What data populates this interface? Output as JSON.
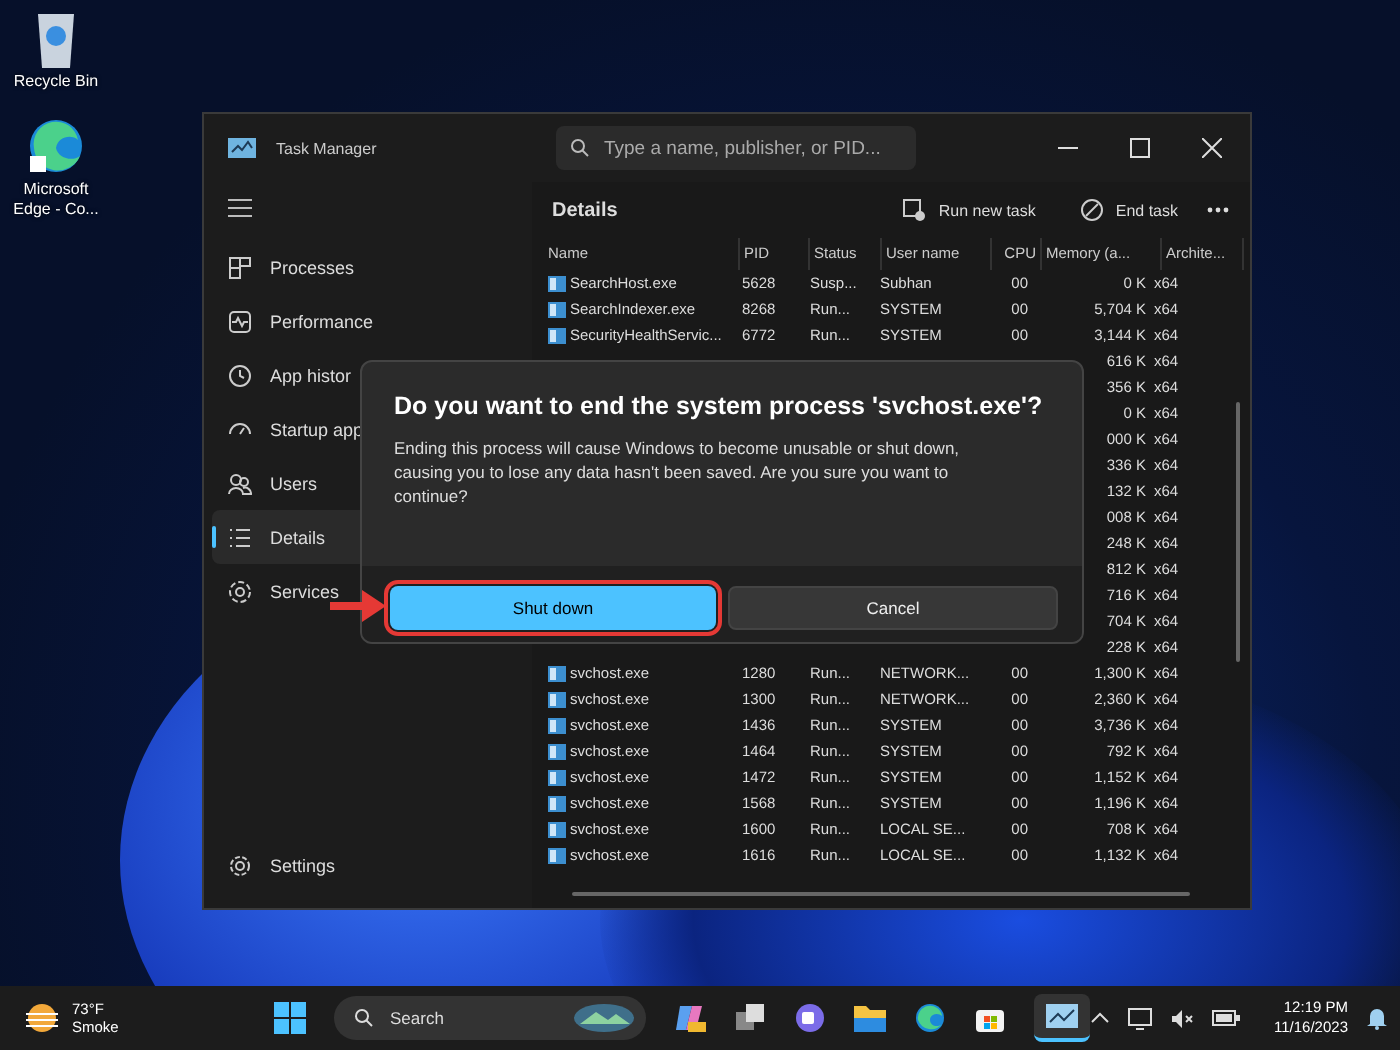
{
  "desktop_icons": [
    {
      "label": "Recycle Bin",
      "kind": "bin"
    },
    {
      "label": "Microsoft Edge - Co...",
      "kind": "edge"
    }
  ],
  "window": {
    "title": "Task Manager",
    "search": {
      "placeholder": "Type a name, publisher, or PID..."
    },
    "nav": [
      {
        "label": "Processes",
        "kind": "processes",
        "selected": false
      },
      {
        "label": "Performance",
        "kind": "performance",
        "selected": false
      },
      {
        "label": "App histor",
        "kind": "history",
        "selected": false
      },
      {
        "label": "Startup app",
        "kind": "startup",
        "selected": false
      },
      {
        "label": "Users",
        "kind": "users",
        "selected": false
      },
      {
        "label": "Details",
        "kind": "details",
        "selected": true
      },
      {
        "label": "Services",
        "kind": "services",
        "selected": false
      }
    ],
    "settings": "Settings",
    "page_title": "Details",
    "toolbar": [
      {
        "label": "Run new task",
        "kind": "run"
      },
      {
        "label": "End task",
        "kind": "end"
      }
    ],
    "columns": [
      "Name",
      "PID",
      "Status",
      "User name",
      "CPU",
      "Memory (a...",
      "Archite..."
    ],
    "rows": [
      {
        "kind": "full",
        "cells": [
          "SearchHost.exe",
          "5628",
          "Susp...",
          "Subhan",
          "00",
          "0 K",
          "x64"
        ]
      },
      {
        "kind": "full",
        "cells": [
          "SearchIndexer.exe",
          "8268",
          "Run...",
          "SYSTEM",
          "00",
          "5,704 K",
          "x64"
        ]
      },
      {
        "kind": "full",
        "cells": [
          "SecurityHealthServic...",
          "6772",
          "Run...",
          "SYSTEM",
          "00",
          "3,144 K",
          "x64"
        ]
      },
      {
        "kind": "covered",
        "cells": [
          "616 K",
          "x64"
        ]
      },
      {
        "kind": "covered",
        "cells": [
          "356 K",
          "x64"
        ]
      },
      {
        "kind": "covered",
        "cells": [
          "0 K",
          "x64"
        ]
      },
      {
        "kind": "covered",
        "cells": [
          "000 K",
          "x64"
        ]
      },
      {
        "kind": "covered",
        "cells": [
          "336 K",
          "x64"
        ]
      },
      {
        "kind": "covered",
        "cells": [
          "132 K",
          "x64"
        ]
      },
      {
        "kind": "covered",
        "cells": [
          "008 K",
          "x64"
        ]
      },
      {
        "kind": "covered",
        "cells": [
          "248 K",
          "x64"
        ]
      },
      {
        "kind": "covered",
        "cells": [
          "812 K",
          "x64"
        ]
      },
      {
        "kind": "covered",
        "cells": [
          "716 K",
          "x64"
        ]
      },
      {
        "kind": "covered",
        "cells": [
          "704 K",
          "x64"
        ]
      },
      {
        "kind": "covered",
        "cells": [
          "228 K",
          "x64"
        ]
      },
      {
        "kind": "full",
        "cells": [
          "svchost.exe",
          "1280",
          "Run...",
          "NETWORK...",
          "00",
          "1,300 K",
          "x64"
        ]
      },
      {
        "kind": "full",
        "cells": [
          "svchost.exe",
          "1300",
          "Run...",
          "NETWORK...",
          "00",
          "2,360 K",
          "x64"
        ]
      },
      {
        "kind": "full",
        "cells": [
          "svchost.exe",
          "1436",
          "Run...",
          "SYSTEM",
          "00",
          "3,736 K",
          "x64"
        ]
      },
      {
        "kind": "full",
        "cells": [
          "svchost.exe",
          "1464",
          "Run...",
          "SYSTEM",
          "00",
          "792 K",
          "x64"
        ]
      },
      {
        "kind": "full",
        "cells": [
          "svchost.exe",
          "1472",
          "Run...",
          "SYSTEM",
          "00",
          "1,152 K",
          "x64"
        ]
      },
      {
        "kind": "full",
        "cells": [
          "svchost.exe",
          "1568",
          "Run...",
          "SYSTEM",
          "00",
          "1,196 K",
          "x64"
        ]
      },
      {
        "kind": "full",
        "cells": [
          "svchost.exe",
          "1600",
          "Run...",
          "LOCAL SE...",
          "00",
          "708 K",
          "x64"
        ]
      },
      {
        "kind": "full",
        "cells": [
          "svchost.exe",
          "1616",
          "Run...",
          "LOCAL SE...",
          "00",
          "1,132 K",
          "x64"
        ]
      }
    ]
  },
  "dialog": {
    "title": "Do you want to end the system process 'svchost.exe'?",
    "message": "Ending this process will cause Windows to become unusable or shut down, causing you to lose any data hasn't been saved. Are you sure you want to continue?",
    "buttons": [
      {
        "label": "Shut down",
        "kind": "primary",
        "highlighted": true
      },
      {
        "label": "Cancel",
        "kind": "secondary",
        "highlighted": false
      }
    ]
  },
  "taskbar": {
    "temperature": "73°F",
    "condition": "Smoke",
    "search": "Search",
    "time": "12:19 PM",
    "date": "11/16/2023"
  }
}
